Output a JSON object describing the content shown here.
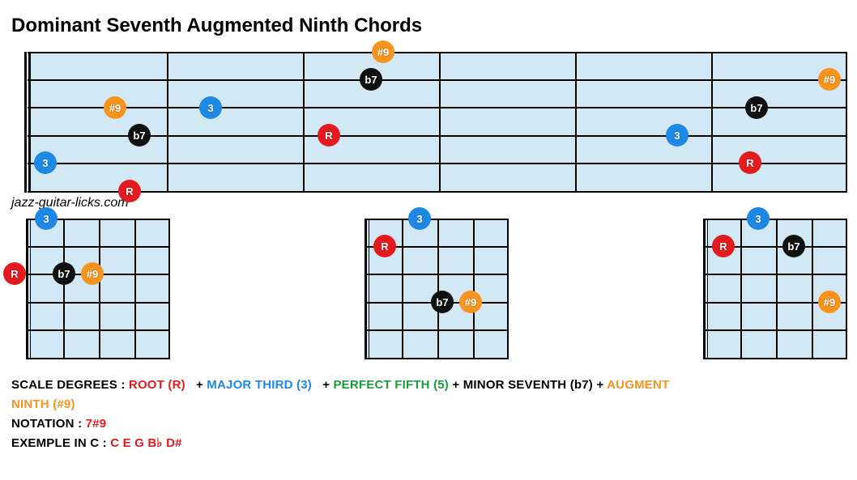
{
  "title": "Dominant Seventh Augmented Ninth Chords",
  "credit": "jazz-guitar-licks.com",
  "colors": {
    "root": "#e31b1e",
    "third": "#1e88e5",
    "seventh": "#111111",
    "ninth": "#f7941e",
    "fifth": "#1a9b3c"
  },
  "chart_data": {
    "type": "fretboard-diagram",
    "main_fretboard": {
      "strings": 6,
      "frets_visible": 6,
      "notes": [
        {
          "string": 1,
          "fret": 1,
          "interval": "R",
          "color": "root"
        },
        {
          "string": 2,
          "fret": 0,
          "interval": "3",
          "color": "third"
        },
        {
          "string": 3,
          "fret": 1,
          "interval": "b7",
          "color": "seventh"
        },
        {
          "string": 4,
          "fret": 1,
          "interval": "#9",
          "color": "ninth"
        },
        {
          "string": 4,
          "fret": 2,
          "interval": "3",
          "color": "third"
        },
        {
          "string": 3,
          "fret": 3,
          "interval": "R",
          "color": "root"
        },
        {
          "string": 5,
          "fret": 3,
          "interval": "b7",
          "color": "seventh"
        },
        {
          "string": 6,
          "fret": 3,
          "interval": "#9",
          "color": "ninth"
        },
        {
          "string": 3,
          "fret": 5,
          "interval": "3",
          "color": "third"
        },
        {
          "string": 4,
          "fret": 5,
          "interval": "b7",
          "color": "seventh"
        },
        {
          "string": 2,
          "fret": 5,
          "interval": "R",
          "color": "root"
        },
        {
          "string": 5,
          "fret": 6,
          "interval": "#9",
          "color": "ninth"
        }
      ]
    },
    "small_fretboards": [
      {
        "strings": 6,
        "frets_visible": 4,
        "notes": [
          {
            "string": 3,
            "fret": 0,
            "interval": "R",
            "color": "root"
          },
          {
            "string": 5,
            "fret": 1,
            "interval": "3",
            "color": "third"
          },
          {
            "string": 4,
            "fret": 2,
            "interval": "b7",
            "color": "seventh"
          },
          {
            "string": 4,
            "fret": 3,
            "interval": "#9",
            "color": "ninth"
          }
        ]
      },
      {
        "strings": 6,
        "frets_visible": 4,
        "notes": [
          {
            "string": 4,
            "fret": 1,
            "interval": "R",
            "color": "root"
          },
          {
            "string": 5,
            "fret": 2,
            "interval": "3",
            "color": "third"
          },
          {
            "string": 3,
            "fret": 3,
            "interval": "b7",
            "color": "seventh"
          },
          {
            "string": 3,
            "fret": 4,
            "interval": "#9",
            "color": "ninth"
          }
        ]
      },
      {
        "strings": 6,
        "frets_visible": 4,
        "notes": [
          {
            "string": 4,
            "fret": 1,
            "interval": "R",
            "color": "root"
          },
          {
            "string": 5,
            "fret": 2,
            "interval": "3",
            "color": "third"
          },
          {
            "string": 4,
            "fret": 3,
            "interval": "b7",
            "color": "seventh"
          },
          {
            "string": 3,
            "fret": 4,
            "interval": "#9",
            "color": "ninth"
          }
        ]
      }
    ]
  },
  "legend": {
    "scale_label": "SCALE DEGREES :",
    "root": "ROOT (R)",
    "plus": "+",
    "third": "MAJOR THIRD (3)",
    "fifth": "PERFECT FIFTH (5)",
    "seventh": "MINOR SEVENTH (b7)",
    "ninth_part1": "AUGMENT",
    "ninth_part2": "NINTH (#9)",
    "notation_label": "NOTATION :",
    "notation_value": "7#9",
    "example_label": "EXEMPLE IN C :",
    "example_value": "C E G B♭ D#"
  }
}
